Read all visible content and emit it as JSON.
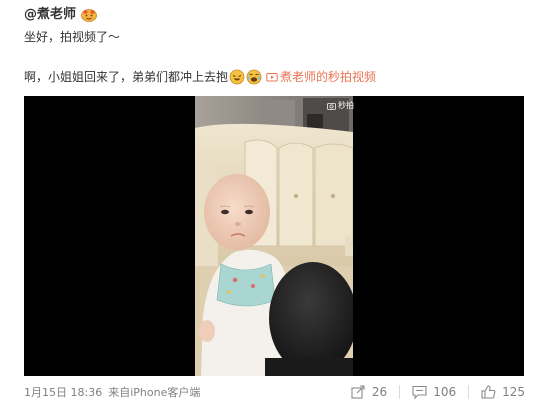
{
  "post": {
    "author": "@煮老师",
    "line1": "坐好，拍视频了～",
    "line2": "啊，小姐姐回来了，弟弟们都冲上去抱",
    "video_link_label": "煮老师的秒拍视频",
    "watermark": "秒拍",
    "timestamp": "1月15日 18:36",
    "source_prefix": "来自",
    "source": "iPhone客户端",
    "reposts": "26",
    "comments": "106",
    "likes": "125",
    "link_color": "#eb7350"
  },
  "icons": {
    "author_badge": "emoji-face-icon",
    "emoji_1": "laughing-emoji-icon",
    "emoji_2": "crying-laughing-emoji-icon",
    "video_link": "video-icon",
    "repost": "repost-icon",
    "comment": "comment-icon",
    "like": "thumbs-up-icon"
  }
}
